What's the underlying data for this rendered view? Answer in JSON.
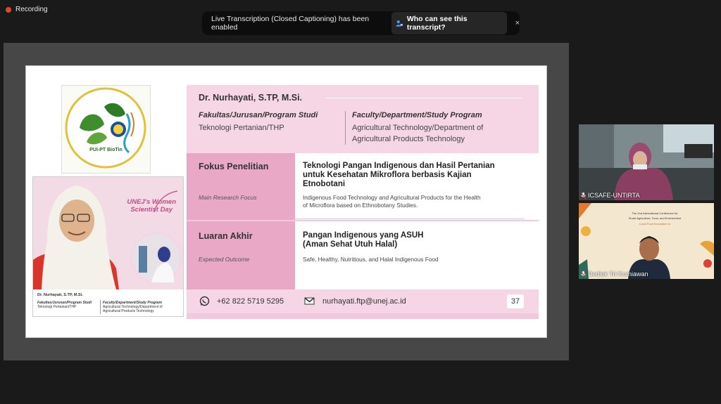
{
  "recording": {
    "label": "Recording"
  },
  "banner": {
    "message": "Live Transcription (Closed Captioning) has been enabled",
    "button_label": "Who can see this transcript?",
    "close": "×"
  },
  "slide": {
    "logo_text": "PUI-PT BioTin",
    "card": {
      "title_line1": "UNEJ's Women",
      "title_line2": "Scientist Day",
      "name": "Dr. Nurhayati, S.TP, M.Si.",
      "fac_label": "Fakultas/Jurusan/Program Studi",
      "fac_value": "Teknologi Pertanian/THP",
      "faculty_label": "Faculty/Department/Study Program",
      "faculty_value": "Agricultural Technology/Department of Agricultural Products Technology"
    },
    "name": "Dr. Nurhayati, S.TP, M.Si.",
    "fac_label": "Fakultas/Jurusan/Program Studi",
    "fac_value": "Teknologi Pertanian/THP",
    "faculty_label": "Faculty/Department/Study Program",
    "faculty_value_line1": "Agricultural Technology/Department of",
    "faculty_value_line2": "Agricultural Products Technology",
    "focus": {
      "label": "Fokus Penelitian",
      "sub": "Main Research Focus",
      "title_line1": "Teknologi Pangan Indigenous dan Hasil Pertanian",
      "title_line2": "untuk Kesehatan Mikroflora berbasis Kajian",
      "title_line3": "Etnobotani",
      "desc_line1": "Indigenous Food Technology and Agricultural Products for the Health",
      "desc_line2": "of Microflora based on Ethnobotany Studies."
    },
    "outcome": {
      "label": "Luaran Akhir",
      "sub": "Expected Outcome",
      "title_line1": "Pangan Indigenous yang ASUH",
      "title_line2": "(Aman Sehat Utuh Halal)",
      "desc": "Safe, Healthy, Nutritious, and Halal Indigenous Food"
    },
    "phone": "+62 822 5719 5295",
    "email": "nurhayati.ftp@unej.ac.id",
    "page": "37"
  },
  "participants": [
    {
      "name": "ICSAFE-UNTIRTA"
    },
    {
      "name": "Dediek Tri Kurniawan"
    }
  ],
  "colors": {
    "pink_light": "#f6d6e4",
    "pink_mid": "#f2c9dc",
    "pink_dark": "#e9a8c6",
    "record": "#e0453a"
  }
}
